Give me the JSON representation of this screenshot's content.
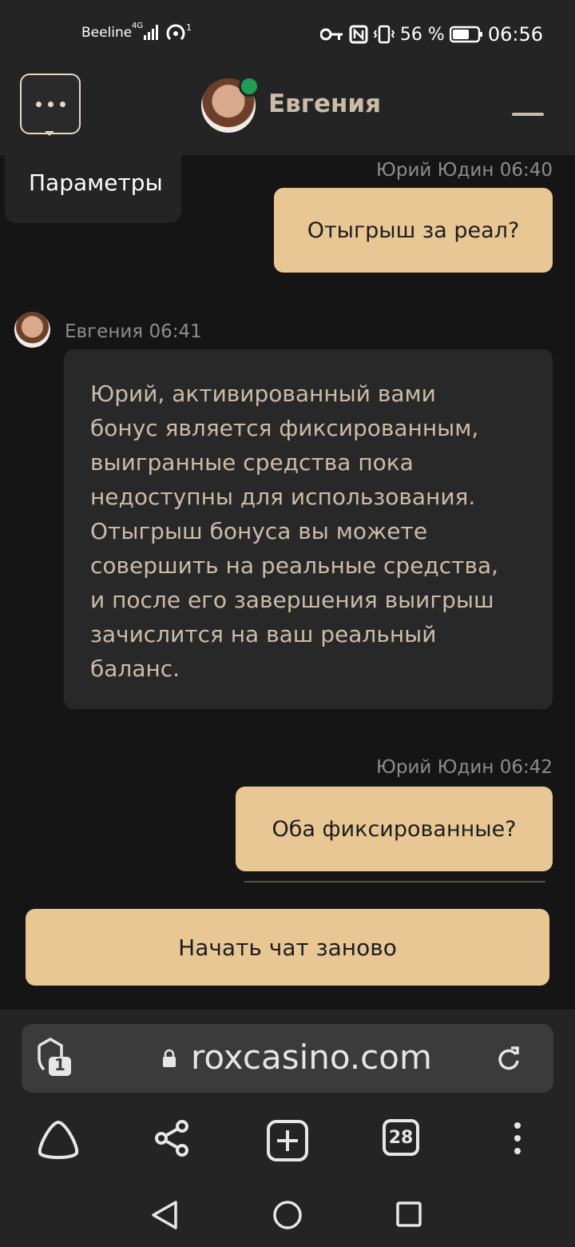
{
  "status_bar": {
    "carrier": "Beeline",
    "network": "4G",
    "hotspot_count": "1",
    "battery_percent": "56 %",
    "time": "06:56"
  },
  "chat_header": {
    "agent_name": "Евгения",
    "online_color": "#1f9d55"
  },
  "menu": {
    "options_label": "Параметры"
  },
  "messages": [
    {
      "sender": "Юрий Юдин 06:40",
      "text": "Отыгрыш за реал?"
    },
    {
      "sender": "Евгения 06:41",
      "lines": [
        "Юрий, активированный вами",
        "бонус является фиксированным,",
        "выигранные средства пока",
        "недоступны для использования.",
        "Отыгрыш бонуса вы можете",
        "совершить на реальные средства,",
        "и после его завершения выигрыш",
        "зачислится на ваш реальный",
        "баланс."
      ]
    },
    {
      "sender": "Юрий Юдин 06:42",
      "text": "Оба фиксированные?"
    }
  ],
  "actions": {
    "restart_chat": "Начать чат заново"
  },
  "browser": {
    "url": "roxcasino.com",
    "shield_badge": "1",
    "tab_count": "28"
  },
  "colors": {
    "accent": "#e8c795",
    "background": "#151515",
    "panel": "#242424",
    "agent_bubble": "#282828",
    "agent_text": "#cbbcaa"
  }
}
